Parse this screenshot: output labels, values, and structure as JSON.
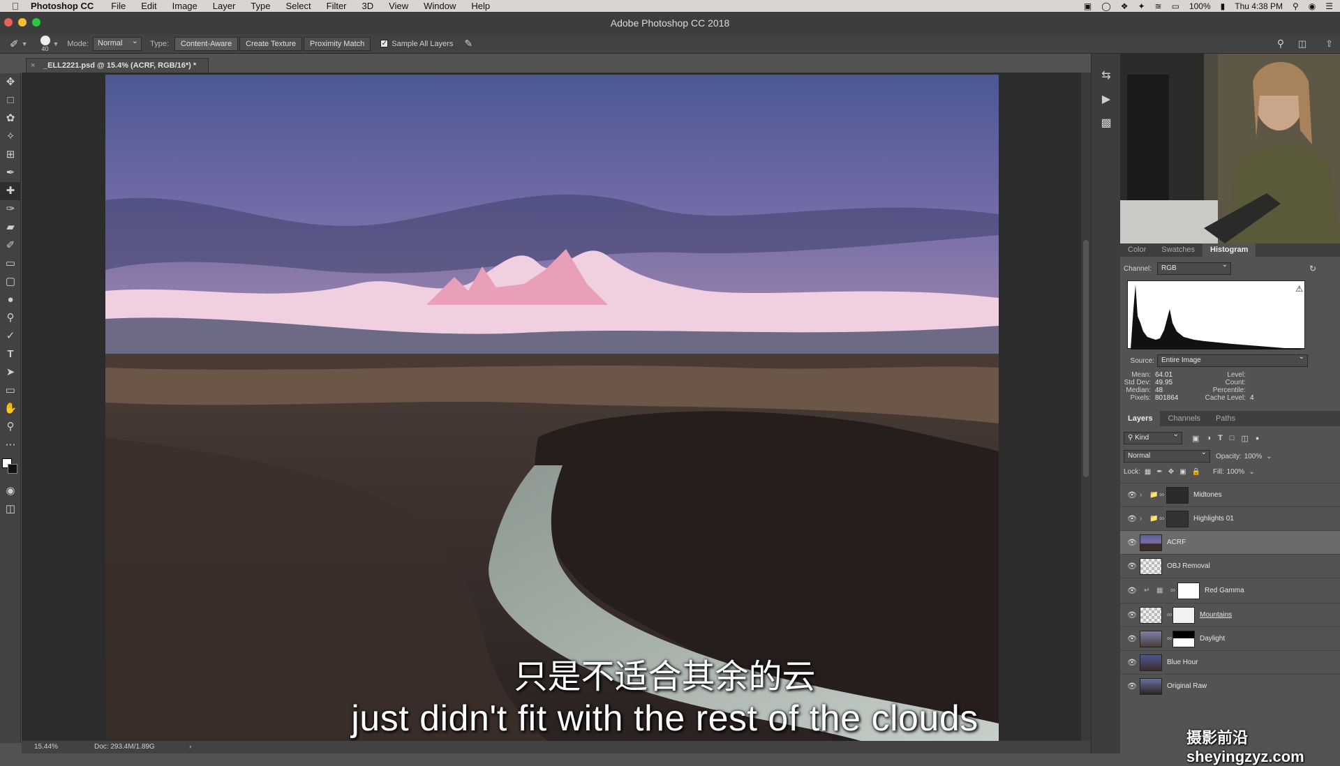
{
  "menubar": {
    "app_name": "Photoshop CC",
    "items": [
      "File",
      "Edit",
      "Image",
      "Layer",
      "Type",
      "Select",
      "Filter",
      "3D",
      "View",
      "Window",
      "Help"
    ],
    "battery": "100%",
    "clock": "Thu 4:38 PM"
  },
  "window": {
    "title": "Adobe Photoshop CC 2018"
  },
  "options": {
    "brush_size": "40",
    "mode_label": "Mode:",
    "mode_value": "Normal",
    "type_label": "Type:",
    "type_buttons": [
      "Content-Aware",
      "Create Texture",
      "Proximity Match"
    ],
    "sample_all_layers": "Sample All Layers"
  },
  "document": {
    "tab_title": "_ELL2221.psd @ 15.4% (ACRF, RGB/16*) *",
    "zoom": "15.44%",
    "doc_size": "Doc: 293.4M/1.89G"
  },
  "histogram_panel": {
    "tabs": [
      "Color",
      "Swatches",
      "Histogram"
    ],
    "active_tab": "Histogram",
    "channel_label": "Channel:",
    "channel_value": "RGB",
    "source_label": "Source:",
    "source_value": "Entire Image",
    "stats": {
      "mean_label": "Mean:",
      "mean": "64.01",
      "stddev_label": "Std Dev:",
      "stddev": "49.95",
      "median_label": "Median:",
      "median": "48",
      "pixels_label": "Pixels:",
      "pixels": "801864",
      "level_label": "Level:",
      "level": "",
      "count_label": "Count:",
      "count": "",
      "percentile_label": "Percentile:",
      "percentile": "",
      "cache_label": "Cache Level:",
      "cache": "4"
    }
  },
  "layers_panel": {
    "tabs": [
      "Layers",
      "Channels",
      "Paths"
    ],
    "active_tab": "Layers",
    "kind_label": "Kind",
    "blend_mode": "Normal",
    "opacity_label": "Opacity:",
    "opacity": "100%",
    "lock_label": "Lock:",
    "fill_label": "Fill:",
    "fill": "100%",
    "layers": [
      {
        "name": "Midtones",
        "type": "group"
      },
      {
        "name": "Highlights 01",
        "type": "group"
      },
      {
        "name": "ACRF",
        "type": "pixel",
        "selected": true
      },
      {
        "name": "OBJ Removal",
        "type": "empty"
      },
      {
        "name": "Red Gamma",
        "type": "adjustment"
      },
      {
        "name": "Mountains",
        "type": "masked"
      },
      {
        "name": "Daylight",
        "type": "masked"
      },
      {
        "name": "Blue Hour",
        "type": "pixel"
      },
      {
        "name": "Original Raw",
        "type": "pixel"
      }
    ]
  },
  "subtitles": {
    "chinese": "只是不适合其余的云",
    "english": "just didn't fit with the rest of the clouds"
  },
  "watermark": "摄影前沿 sheyingzyz.com",
  "colors": {
    "chrome_dark": "#424242",
    "panel": "#535353",
    "menubar": "#d9d5d0"
  }
}
